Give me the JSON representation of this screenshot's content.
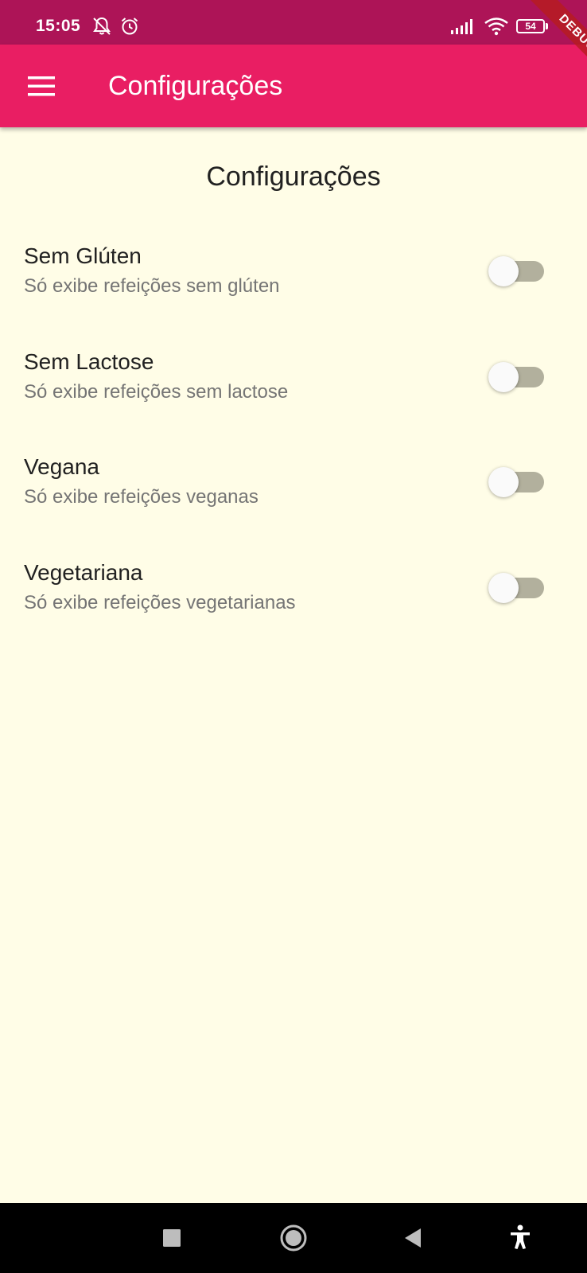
{
  "status_bar": {
    "time": "15:05",
    "battery": "54",
    "icons": [
      "notifications-off-icon",
      "alarm-icon",
      "signal-icon",
      "wifi-icon",
      "battery-icon"
    ]
  },
  "app_bar": {
    "title": "Configurações",
    "menu_icon": "menu-icon"
  },
  "debug_banner": "DEBUG",
  "page": {
    "heading": "Configurações"
  },
  "settings": [
    {
      "title": "Sem Glúten",
      "subtitle": "Só exibe refeições sem glúten",
      "enabled": false
    },
    {
      "title": "Sem Lactose",
      "subtitle": "Só exibe refeições sem lactose",
      "enabled": false
    },
    {
      "title": "Vegana",
      "subtitle": "Só exibe refeições veganas",
      "enabled": false
    },
    {
      "title": "Vegetariana",
      "subtitle": "Só exibe refeições vegetarianas",
      "enabled": false
    }
  ],
  "nav_bar": {
    "icons": [
      "recents-icon",
      "home-icon",
      "back-icon",
      "accessibility-icon"
    ]
  },
  "colors": {
    "status_bar": "#ad1457",
    "app_bar": "#e91e63",
    "background": "#fffde7",
    "switch_track_off": "#b2b09d",
    "switch_thumb_off": "#fafafa"
  }
}
